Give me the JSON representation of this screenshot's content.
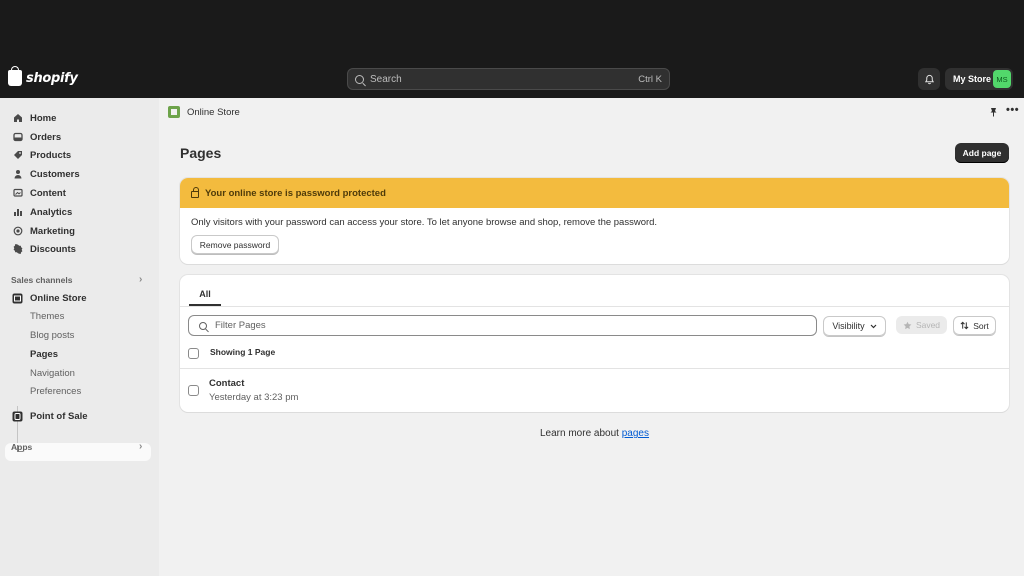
{
  "topbar": {
    "logo_text": "shopify",
    "search_placeholder": "Search",
    "search_shortcut": "Ctrl K",
    "store_name": "My Store",
    "store_initials": "MS"
  },
  "sidebar": {
    "items": [
      {
        "label": "Home",
        "icon": "home-icon"
      },
      {
        "label": "Orders",
        "icon": "orders-icon"
      },
      {
        "label": "Products",
        "icon": "tag-icon"
      },
      {
        "label": "Customers",
        "icon": "person-icon"
      },
      {
        "label": "Content",
        "icon": "content-icon"
      },
      {
        "label": "Analytics",
        "icon": "bar-chart-icon"
      },
      {
        "label": "Marketing",
        "icon": "target-icon"
      },
      {
        "label": "Discounts",
        "icon": "discount-icon"
      }
    ],
    "sales_channels_label": "Sales channels",
    "online_store_label": "Online Store",
    "sub_items": [
      "Themes",
      "Blog posts",
      "Pages",
      "Navigation",
      "Preferences"
    ],
    "point_of_sale_label": "Point of Sale",
    "apps_label": "Apps"
  },
  "main": {
    "breadcrumb": "Online Store",
    "title": "Pages",
    "add_button": "Add page",
    "banner": {
      "title": "Your online store is password protected",
      "text": "Only visitors with your password can access your store. To let anyone browse and shop, remove the password.",
      "button": "Remove password"
    },
    "tabs": [
      "All"
    ],
    "filter_placeholder": "Filter Pages",
    "visibility_label": "Visibility",
    "saved_label": "Saved",
    "sort_label": "Sort",
    "showing_label": "Showing 1 Page",
    "rows": [
      {
        "title": "Contact",
        "subtitle": "Yesterday at 3:23 pm"
      }
    ],
    "learn_more_prefix": "Learn more about",
    "learn_more_link": "pages"
  },
  "colors": {
    "banner_bg": "#f3bb3e",
    "avatar_bg": "#52d86b",
    "link": "#005bd3"
  }
}
